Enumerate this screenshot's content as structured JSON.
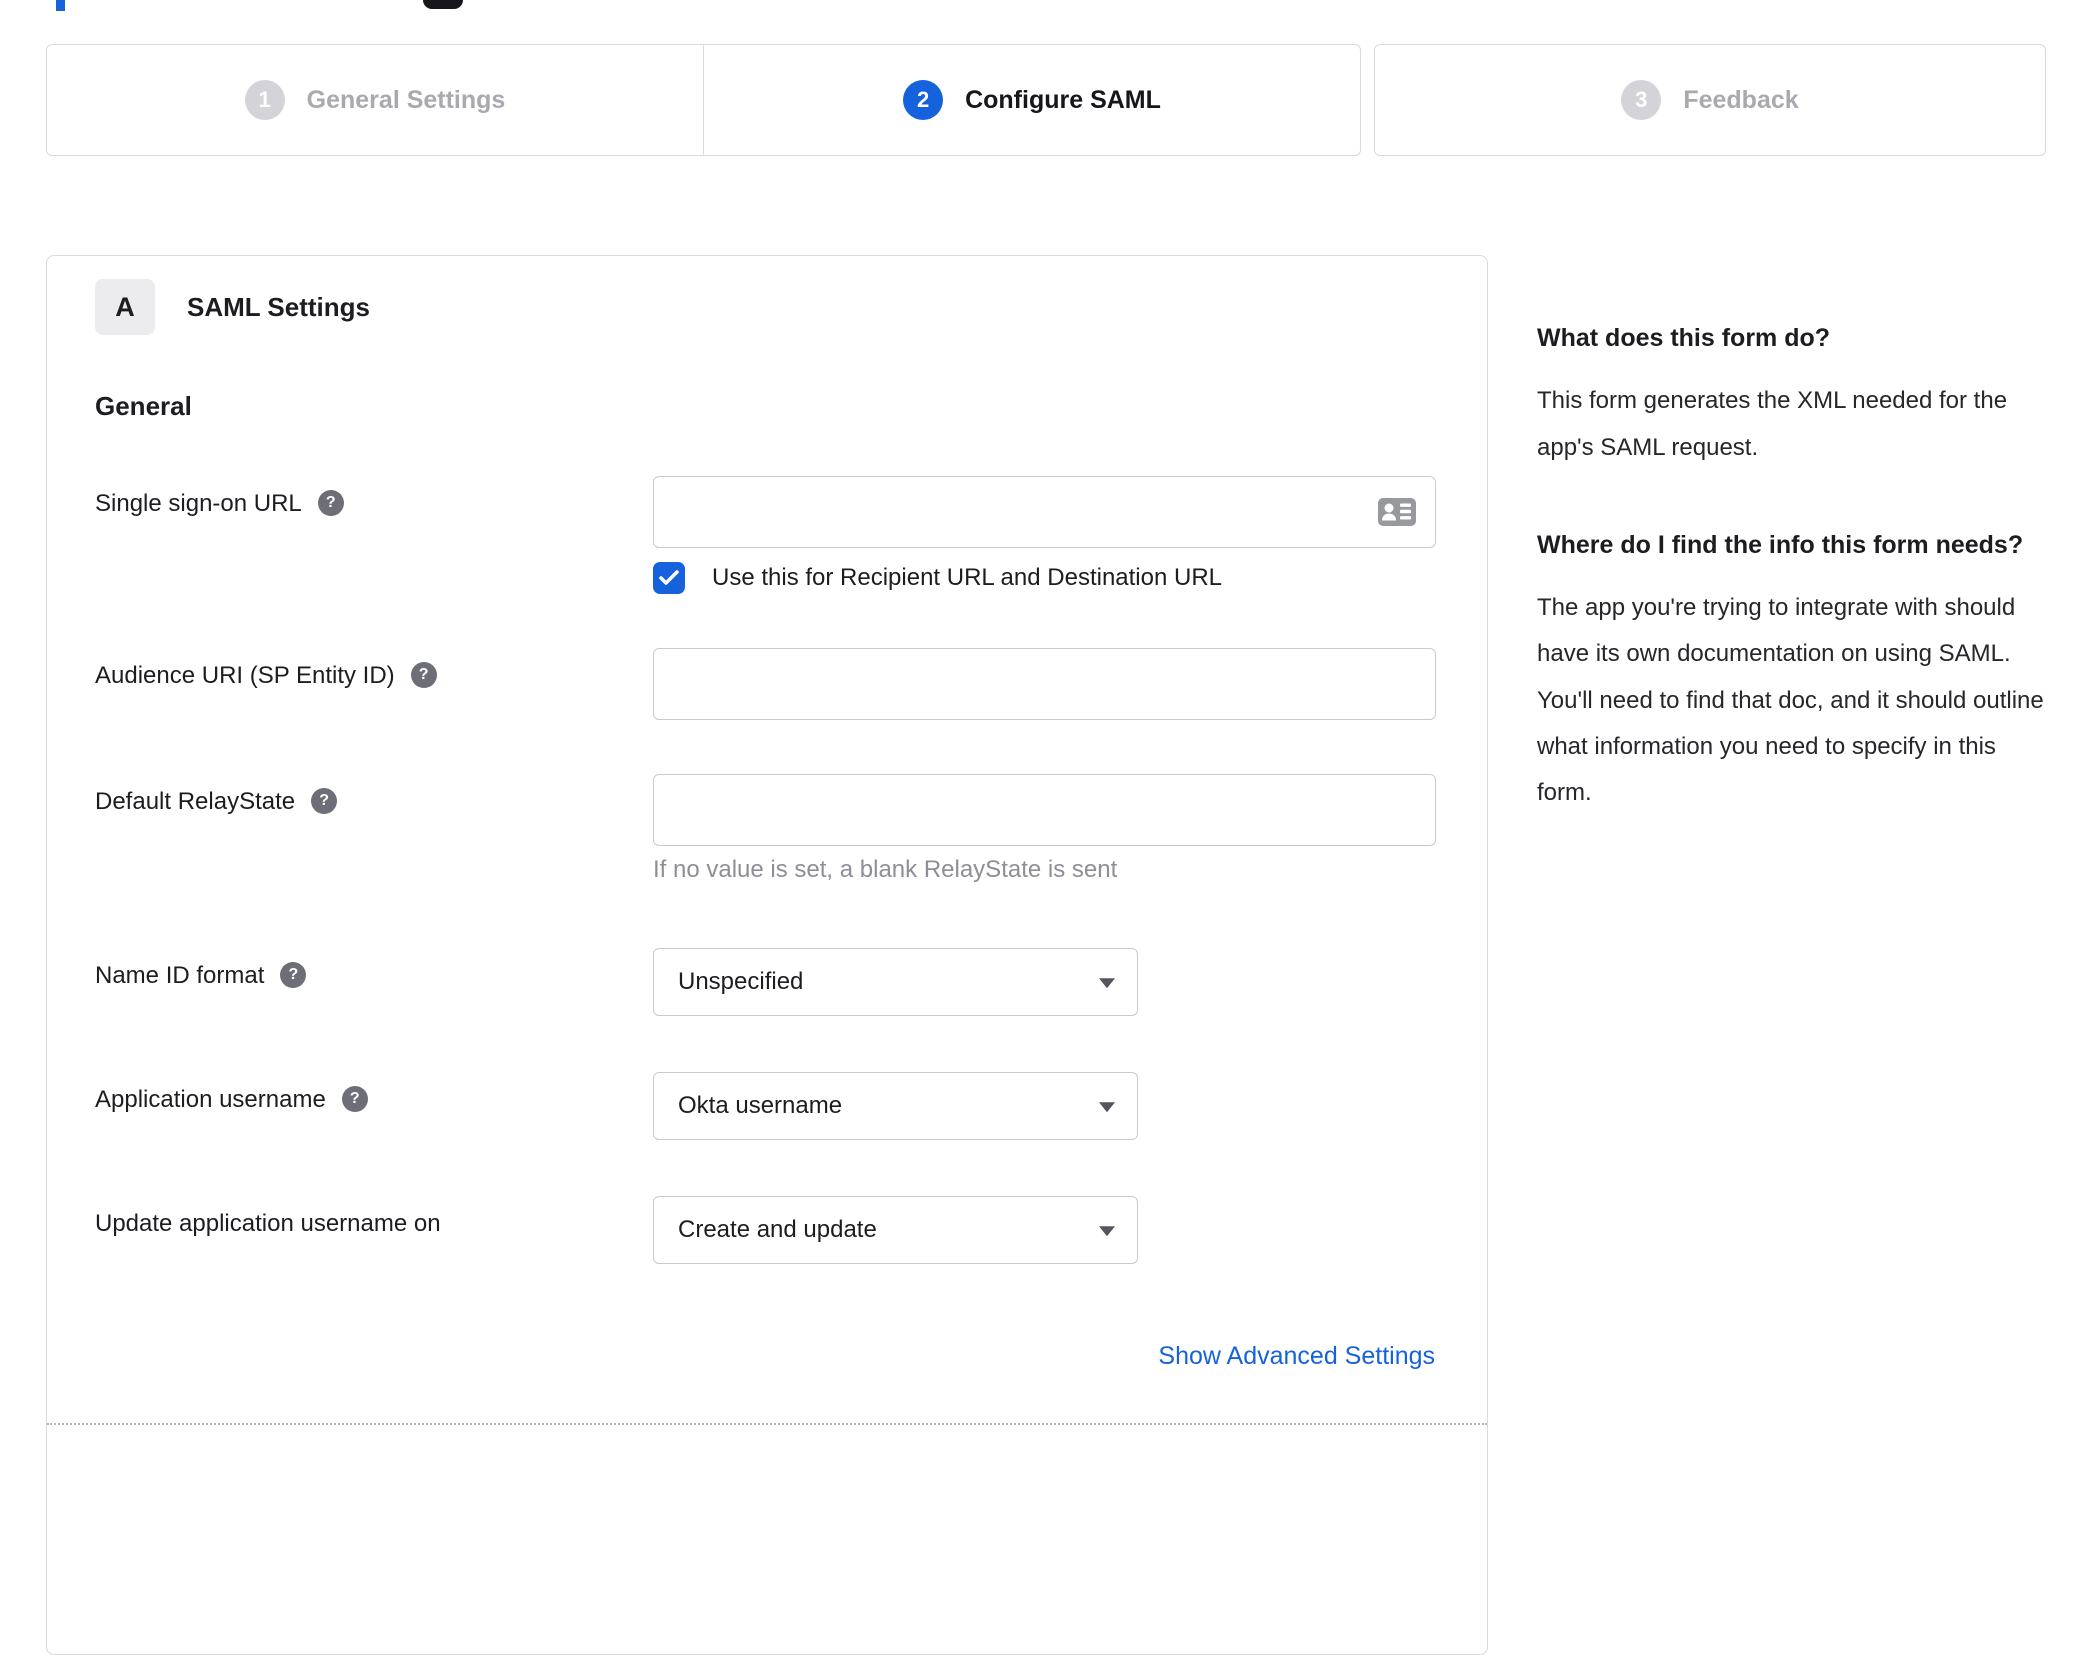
{
  "stepper": {
    "steps": [
      {
        "number": "1",
        "label": "General Settings",
        "state": "inactive"
      },
      {
        "number": "2",
        "label": "Configure SAML",
        "state": "active"
      },
      {
        "number": "3",
        "label": "Feedback",
        "state": "inactive"
      }
    ]
  },
  "panel": {
    "badge": "A",
    "title": "SAML Settings",
    "section_heading": "General",
    "fields": [
      {
        "label": "Single sign-on URL",
        "type": "text",
        "value": "",
        "checkbox": {
          "checked": true,
          "label": "Use this for Recipient URL and Destination URL"
        }
      },
      {
        "label": "Audience URI (SP Entity ID)",
        "type": "text",
        "value": ""
      },
      {
        "label": "Default RelayState",
        "type": "text",
        "value": "",
        "helper": "If no value is set, a blank RelayState is sent"
      },
      {
        "label": "Name ID format",
        "type": "select",
        "value": "Unspecified"
      },
      {
        "label": "Application username",
        "type": "select",
        "value": "Okta username"
      },
      {
        "label": "Update application username on",
        "type": "select",
        "value": "Create and update"
      }
    ],
    "advanced_link": "Show Advanced Settings"
  },
  "help": {
    "sections": [
      {
        "heading": "What does this form do?",
        "body": "This form generates the XML needed for the app's SAML request."
      },
      {
        "heading": "Where do I find the info this form needs?",
        "body": "The app you're trying to integrate with should have its own documentation on using SAML. You'll need to find that doc, and it should outline what information you need to specify in this form."
      }
    ]
  },
  "icons": {
    "help_glyph": "?",
    "help": "question-mark-circle",
    "input_icon": "contact-card",
    "select_icon": "caret-down",
    "checkbox_icon": "checkmark"
  },
  "colors": {
    "accent_blue": "#1662dd",
    "border_gray": "#d9d9de",
    "inactive_step_gray": "#d3d3d8",
    "helper_text_gray": "#8e8e96"
  }
}
